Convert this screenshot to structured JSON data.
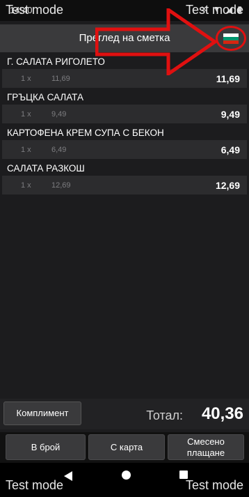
{
  "status": {
    "time": "14:40",
    "icons": "✕ ▼ ◢ ▮"
  },
  "watermark": {
    "text": "Test mode"
  },
  "header": {
    "title": "Преглед на сметка"
  },
  "flag_colors": [
    "#ffffff",
    "#00966e",
    "#d62612"
  ],
  "annotation_color": "#e01010",
  "items": [
    {
      "name": "Г. САЛАТА РИГОЛЕТО",
      "qty": "1 x",
      "unit_price": "11,69",
      "line_total": "11,69"
    },
    {
      "name": "ГРЪЦКА САЛАТА",
      "qty": "1 x",
      "unit_price": "9,49",
      "line_total": "9,49"
    },
    {
      "name": "КАРТОФЕНА КРЕМ СУПА С БЕКОН",
      "qty": "1 x",
      "unit_price": "6,49",
      "line_total": "6,49"
    },
    {
      "name": "САЛАТА РАЗКОШ",
      "qty": "1 x",
      "unit_price": "12,69",
      "line_total": "12,69"
    }
  ],
  "footer": {
    "compliment_label": "Комплимент",
    "total_label": "Тотал:",
    "total_value": "40,36"
  },
  "payment": {
    "cash_label": "В брой",
    "card_label": "С карта",
    "mixed_label_1": "Смесено",
    "mixed_label_2": "плащане"
  }
}
